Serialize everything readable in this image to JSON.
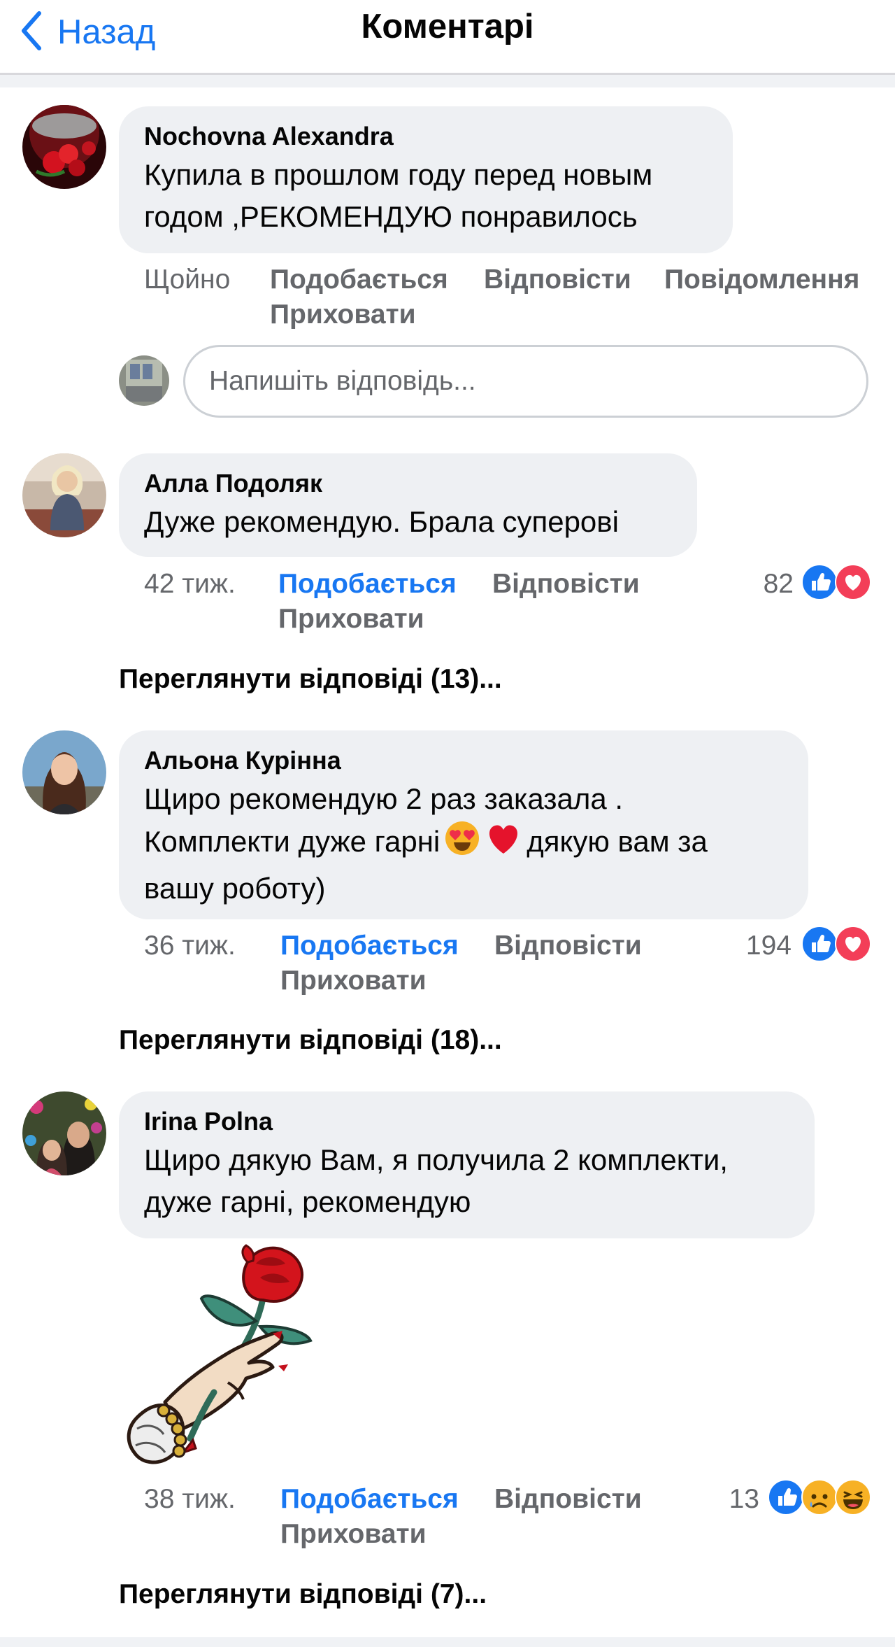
{
  "header": {
    "back_label": "Назад",
    "title": "Коментарі"
  },
  "reply_box": {
    "placeholder": "Напишіть відповідь..."
  },
  "comments": [
    {
      "author": "Nochovna Alexandra",
      "lines": [
        "Купила в прошлом году перед новым",
        "годом ,РЕКОМЕНДУЮ понравилось"
      ],
      "time": "Щойно",
      "like": "Подобається",
      "reply": "Відповісти",
      "report": "Повідомлення",
      "hide": "Приховати"
    },
    {
      "author": "Алла Подоляк",
      "lines": [
        "Дуже рекомендую. Брала суперові"
      ],
      "time": "42 тиж.",
      "like": "Подобається",
      "reply": "Відповісти",
      "hide": "Приховати",
      "reaction_count": "82",
      "reactions": [
        "like-icon",
        "heart-icon"
      ],
      "view_replies": "Переглянути відповіді (13)..."
    },
    {
      "author": "Альона Курінна",
      "line1": "Щиро рекомендую 2 раз заказала .",
      "line2_before": "Комплекти дуже гарні",
      "line2_emojis": [
        "heart-eyes-emoji",
        "red-heart-emoji"
      ],
      "line2_after": "дякую вам за",
      "line3": "вашу роботу)",
      "time": "36 тиж.",
      "like": "Подобається",
      "reply": "Відповісти",
      "hide": "Приховати",
      "reaction_count": "194",
      "reactions": [
        "like-icon",
        "heart-icon"
      ],
      "view_replies": "Переглянути відповіді (18)..."
    },
    {
      "author": "Irina Polna",
      "lines": [
        "Щиро дякую Вам, я получила 2 комплекти,",
        "дуже гарні, рекомендую"
      ],
      "sticker": "hand-holding-rose-sticker",
      "time": "38 тиж.",
      "like": "Подобається",
      "reply": "Відповісти",
      "hide": "Приховати",
      "reaction_count": "13",
      "reactions": [
        "like-icon",
        "sad-icon",
        "haha-icon"
      ],
      "view_replies": "Переглянути відповіді (7)..."
    }
  ],
  "colors": {
    "accent": "#1877f2",
    "secondary_text": "#65676b",
    "bubble": "#eef0f3",
    "love": "#f33e58"
  }
}
